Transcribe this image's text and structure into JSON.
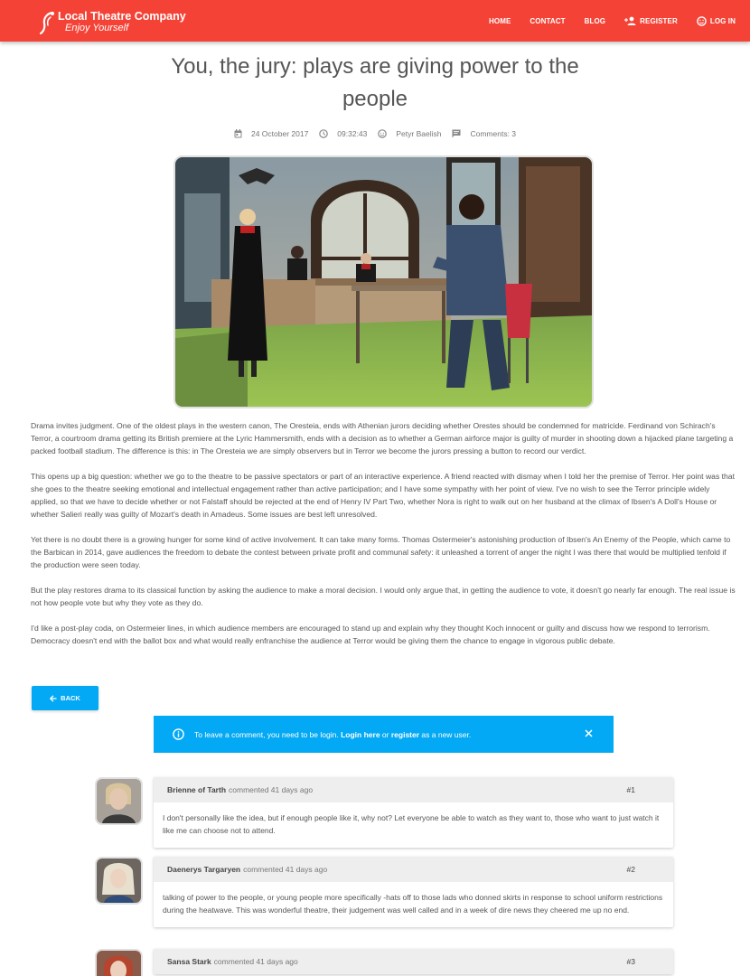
{
  "brand": {
    "title": "Local Theatre Company",
    "tagline": "Enjoy Yourself"
  },
  "nav": {
    "home": "HOME",
    "contact": "CONTACT",
    "blog": "BLOG",
    "register": "REGISTER",
    "login": "LOG IN"
  },
  "article": {
    "title_line1": "You, the jury: plays are giving power to the",
    "title_line2": "people",
    "date": "24 October 2017",
    "time": "09:32:43",
    "author": "Petyr Baelish",
    "comments": "Comments: 3",
    "paragraphs": [
      "Drama invites judgment. One of the oldest plays in the western canon, The Oresteia, ends with Athenian jurors deciding whether Orestes should be condemned for matricide. Ferdinand von Schirach's Terror, a courtroom drama getting its British premiere at the Lyric Hammersmith, ends with a decision as to whether a German airforce major is guilty of murder in shooting down a hijacked plane targeting a packed football stadium. The difference is this: in The Oresteia we are simply observers but in Terror we become the jurors pressing a button to record our verdict.",
      "This opens up a big question: whether we go to the theatre to be passive spectators or part of an interactive experience. A friend reacted with dismay when I told her the premise of Terror. Her point was that she goes to the theatre seeking emotional and intellectual engagement rather than active participation; and I have some sympathy with her point of view. I've no wish to see the Terror principle widely applied, so that we have to decide whether or not Falstaff should be rejected at the end of Henry IV Part Two, whether Nora is right to walk out on her husband at the climax of Ibsen's A Doll's House or whether Salieri really was guilty of Mozart's death in Amadeus. Some issues are best left unresolved.",
      "Yet there is no doubt there is a growing hunger for some kind of active involvement. It can take many forms. Thomas Ostermeier's astonishing production of Ibsen's An Enemy of the People, which came to the Barbican in 2014, gave audiences the freedom to debate the contest between private profit and communal safety: it unleashed a torrent of anger the night I was there that would be multiplied tenfold if the production were seen today.",
      "But the play restores drama to its classical function by asking the audience to make a moral decision. I would only argue that, in getting the audience to vote, it doesn't go nearly far enough. The real issue is not how people vote but why they vote as they do.",
      "I'd like a post-play coda, on Ostermeier lines, in which audience members are encouraged to stand up and explain why they thought Koch innocent or guilty and discuss how we respond to terrorism. Democracy doesn't end with the ballot box and what would really enfranchise the audience at Terror would be giving them the chance to engage in vigorous public debate."
    ]
  },
  "back_button": "BACK",
  "alert": {
    "prefix": "To leave a comment, you need to be login.",
    "login_link": "Login here",
    "middle": "or",
    "register_link": "register",
    "suffix": "as a new user."
  },
  "comments": [
    {
      "author": "Brienne of Tarth",
      "meta": "commented 41 days ago",
      "num": "#1",
      "text": "I don't personally like the idea, but if enough people like it, why not? Let everyone be able to watch as they want to, those who want to just watch it like me can choose not to attend."
    },
    {
      "author": "Daenerys Targaryen",
      "meta": "commented 41 days ago",
      "num": "#2",
      "text": "talking of power to the people, or young people more specifically -hats off to those lads who donned skirts in response to school uniform restrictions during the heatwave. This was wonderful theatre, their judgement was well called and in a week of dire news they cheered me up no end."
    },
    {
      "author": "Sansa Stark",
      "meta": "commented 41 days ago",
      "num": "#3",
      "text": ""
    }
  ],
  "colors": {
    "primary": "#f44336",
    "accent": "#03a9f4"
  }
}
